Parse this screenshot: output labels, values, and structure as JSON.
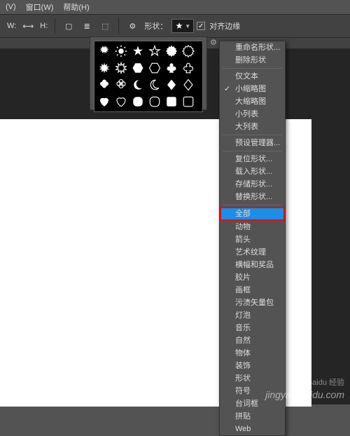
{
  "menubar": {
    "view": "(V)",
    "window": "窗口(W)",
    "help": "帮助(H)"
  },
  "toolbar": {
    "w_label": "W:",
    "h_label": "H:",
    "shape_label": "形状：",
    "align_label": "对齐边缘"
  },
  "shapes_panel": {
    "shapes": [
      "star12",
      "sun",
      "star5",
      "star5o",
      "star24",
      "star24o",
      "seal",
      "seal-o",
      "hex",
      "hexo",
      "club",
      "clubo",
      "clover",
      "clovero",
      "moon",
      "moono",
      "diamond",
      "diamondo",
      "heart",
      "hearto",
      "squircle",
      "squircleo",
      "rsquare",
      "rsquareo"
    ]
  },
  "context_menu": {
    "items": [
      {
        "t": "重命名形状..."
      },
      {
        "t": "删除形状"
      },
      {
        "sep": 1
      },
      {
        "t": "仅文本"
      },
      {
        "t": "小缩略图",
        "c": 1
      },
      {
        "t": "大缩略图"
      },
      {
        "t": "小列表"
      },
      {
        "t": "大列表"
      },
      {
        "sep": 1
      },
      {
        "t": "预设管理器..."
      },
      {
        "sep": 1
      },
      {
        "t": "复位形状..."
      },
      {
        "t": "载入形状..."
      },
      {
        "t": "存储形状..."
      },
      {
        "t": "替换形状..."
      },
      {
        "sep": 1
      },
      {
        "t": "全部",
        "h": 1
      },
      {
        "t": "动物"
      },
      {
        "t": "箭头"
      },
      {
        "t": "艺术纹理"
      },
      {
        "t": "横幅和奖品"
      },
      {
        "t": "胶片"
      },
      {
        "t": "画框"
      },
      {
        "t": "污渍矢量包"
      },
      {
        "t": "灯泡"
      },
      {
        "t": "音乐"
      },
      {
        "t": "自然"
      },
      {
        "t": "物体"
      },
      {
        "t": "装饰"
      },
      {
        "t": "形状"
      },
      {
        "t": "符号"
      },
      {
        "t": "台词框"
      },
      {
        "t": "拼贴"
      },
      {
        "t": "Web"
      }
    ]
  },
  "watermark": {
    "line1": "Baidu 经验",
    "line2": "jingyan.baidu.com"
  }
}
